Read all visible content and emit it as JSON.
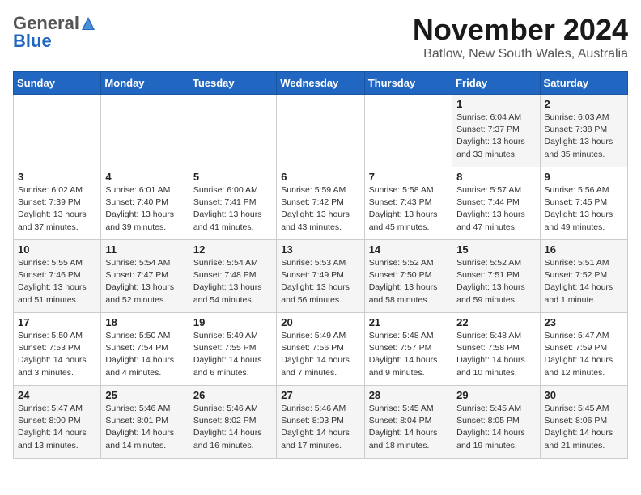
{
  "header": {
    "logo_general": "General",
    "logo_blue": "Blue",
    "month": "November 2024",
    "location": "Batlow, New South Wales, Australia"
  },
  "weekdays": [
    "Sunday",
    "Monday",
    "Tuesday",
    "Wednesday",
    "Thursday",
    "Friday",
    "Saturday"
  ],
  "weeks": [
    [
      {
        "day": "",
        "info": ""
      },
      {
        "day": "",
        "info": ""
      },
      {
        "day": "",
        "info": ""
      },
      {
        "day": "",
        "info": ""
      },
      {
        "day": "",
        "info": ""
      },
      {
        "day": "1",
        "info": "Sunrise: 6:04 AM\nSunset: 7:37 PM\nDaylight: 13 hours\nand 33 minutes."
      },
      {
        "day": "2",
        "info": "Sunrise: 6:03 AM\nSunset: 7:38 PM\nDaylight: 13 hours\nand 35 minutes."
      }
    ],
    [
      {
        "day": "3",
        "info": "Sunrise: 6:02 AM\nSunset: 7:39 PM\nDaylight: 13 hours\nand 37 minutes."
      },
      {
        "day": "4",
        "info": "Sunrise: 6:01 AM\nSunset: 7:40 PM\nDaylight: 13 hours\nand 39 minutes."
      },
      {
        "day": "5",
        "info": "Sunrise: 6:00 AM\nSunset: 7:41 PM\nDaylight: 13 hours\nand 41 minutes."
      },
      {
        "day": "6",
        "info": "Sunrise: 5:59 AM\nSunset: 7:42 PM\nDaylight: 13 hours\nand 43 minutes."
      },
      {
        "day": "7",
        "info": "Sunrise: 5:58 AM\nSunset: 7:43 PM\nDaylight: 13 hours\nand 45 minutes."
      },
      {
        "day": "8",
        "info": "Sunrise: 5:57 AM\nSunset: 7:44 PM\nDaylight: 13 hours\nand 47 minutes."
      },
      {
        "day": "9",
        "info": "Sunrise: 5:56 AM\nSunset: 7:45 PM\nDaylight: 13 hours\nand 49 minutes."
      }
    ],
    [
      {
        "day": "10",
        "info": "Sunrise: 5:55 AM\nSunset: 7:46 PM\nDaylight: 13 hours\nand 51 minutes."
      },
      {
        "day": "11",
        "info": "Sunrise: 5:54 AM\nSunset: 7:47 PM\nDaylight: 13 hours\nand 52 minutes."
      },
      {
        "day": "12",
        "info": "Sunrise: 5:54 AM\nSunset: 7:48 PM\nDaylight: 13 hours\nand 54 minutes."
      },
      {
        "day": "13",
        "info": "Sunrise: 5:53 AM\nSunset: 7:49 PM\nDaylight: 13 hours\nand 56 minutes."
      },
      {
        "day": "14",
        "info": "Sunrise: 5:52 AM\nSunset: 7:50 PM\nDaylight: 13 hours\nand 58 minutes."
      },
      {
        "day": "15",
        "info": "Sunrise: 5:52 AM\nSunset: 7:51 PM\nDaylight: 13 hours\nand 59 minutes."
      },
      {
        "day": "16",
        "info": "Sunrise: 5:51 AM\nSunset: 7:52 PM\nDaylight: 14 hours\nand 1 minute."
      }
    ],
    [
      {
        "day": "17",
        "info": "Sunrise: 5:50 AM\nSunset: 7:53 PM\nDaylight: 14 hours\nand 3 minutes."
      },
      {
        "day": "18",
        "info": "Sunrise: 5:50 AM\nSunset: 7:54 PM\nDaylight: 14 hours\nand 4 minutes."
      },
      {
        "day": "19",
        "info": "Sunrise: 5:49 AM\nSunset: 7:55 PM\nDaylight: 14 hours\nand 6 minutes."
      },
      {
        "day": "20",
        "info": "Sunrise: 5:49 AM\nSunset: 7:56 PM\nDaylight: 14 hours\nand 7 minutes."
      },
      {
        "day": "21",
        "info": "Sunrise: 5:48 AM\nSunset: 7:57 PM\nDaylight: 14 hours\nand 9 minutes."
      },
      {
        "day": "22",
        "info": "Sunrise: 5:48 AM\nSunset: 7:58 PM\nDaylight: 14 hours\nand 10 minutes."
      },
      {
        "day": "23",
        "info": "Sunrise: 5:47 AM\nSunset: 7:59 PM\nDaylight: 14 hours\nand 12 minutes."
      }
    ],
    [
      {
        "day": "24",
        "info": "Sunrise: 5:47 AM\nSunset: 8:00 PM\nDaylight: 14 hours\nand 13 minutes."
      },
      {
        "day": "25",
        "info": "Sunrise: 5:46 AM\nSunset: 8:01 PM\nDaylight: 14 hours\nand 14 minutes."
      },
      {
        "day": "26",
        "info": "Sunrise: 5:46 AM\nSunset: 8:02 PM\nDaylight: 14 hours\nand 16 minutes."
      },
      {
        "day": "27",
        "info": "Sunrise: 5:46 AM\nSunset: 8:03 PM\nDaylight: 14 hours\nand 17 minutes."
      },
      {
        "day": "28",
        "info": "Sunrise: 5:45 AM\nSunset: 8:04 PM\nDaylight: 14 hours\nand 18 minutes."
      },
      {
        "day": "29",
        "info": "Sunrise: 5:45 AM\nSunset: 8:05 PM\nDaylight: 14 hours\nand 19 minutes."
      },
      {
        "day": "30",
        "info": "Sunrise: 5:45 AM\nSunset: 8:06 PM\nDaylight: 14 hours\nand 21 minutes."
      }
    ]
  ]
}
